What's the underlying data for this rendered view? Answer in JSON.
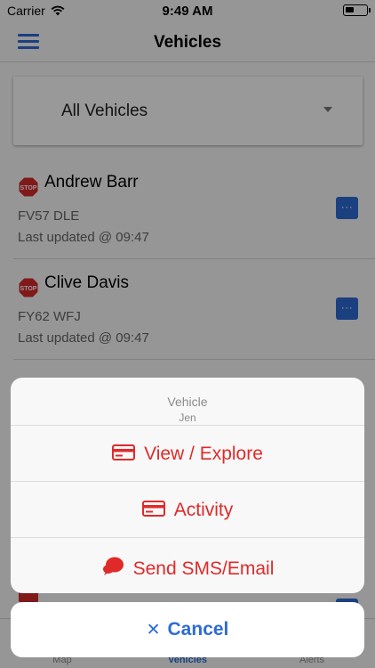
{
  "status_bar": {
    "carrier": "Carrier",
    "time": "9:49 AM"
  },
  "nav": {
    "title": "Vehicles"
  },
  "filter": {
    "selected": "All Vehicles"
  },
  "vehicles": [
    {
      "driver": "Andrew Barr",
      "registration": "FV57 DLE",
      "last_updated": "Last updated @ 09:47",
      "status_icon": "stop-sign-icon",
      "more_label": "···"
    },
    {
      "driver": "Clive Davis",
      "registration": "FY62 WFJ",
      "last_updated": "Last updated @ 09:47",
      "status_icon": "stop-sign-icon",
      "more_label": "···"
    }
  ],
  "tabs": [
    {
      "label": "Map",
      "active": false
    },
    {
      "label": "Vehicles",
      "active": true
    },
    {
      "label": "Alerts",
      "active": false
    }
  ],
  "action_sheet": {
    "title": "Vehicle",
    "subtitle": "Jen",
    "actions": [
      {
        "label": "View / Explore",
        "icon": "card-icon"
      },
      {
        "label": "Activity",
        "icon": "card-icon"
      },
      {
        "label": "Send SMS/Email",
        "icon": "chat-bubble-icon"
      }
    ],
    "cancel_label": "Cancel",
    "action_color": "#e02a2a",
    "cancel_color": "#2d6cd6"
  },
  "colors": {
    "accent": "#2d6cd6",
    "stop": "#d62b2b"
  }
}
